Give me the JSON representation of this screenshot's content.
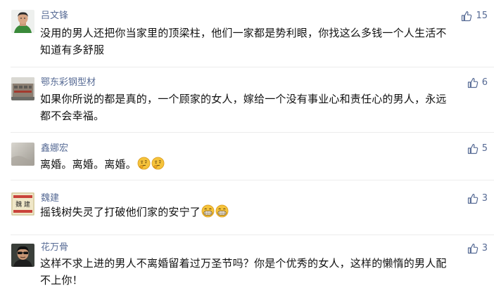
{
  "comments": [
    {
      "user": "吕文锋",
      "likes": "15",
      "text_lines": [
        "没用的男人还把你当家里的顶梁柱，他们一家都是势利眼，你找这么多钱一个人生活不",
        "知道有多舒服"
      ],
      "emoji": []
    },
    {
      "user": "鄂东彩钢型材",
      "likes": "6",
      "text_lines": [
        "如果你所说的都是真的，一个顾家的女人，嫁给一个没有事业心和责任心的男人，永远",
        "都不会幸福。"
      ],
      "emoji": []
    },
    {
      "user": "鑫娜宏",
      "likes": "5",
      "text_lines": [
        "离婚。离婚。离婚。"
      ],
      "emoji": [
        "thinking-emoji",
        "thinking-emoji"
      ]
    },
    {
      "user": "魏建",
      "likes": "3",
      "text_lines": [
        "摇钱树失灵了打破他们家的安宁了"
      ],
      "emoji": [
        "grin-emoji",
        "grin-emoji"
      ]
    },
    {
      "user": "花万骨",
      "likes": "3",
      "text_lines": [
        "这样不求上进的男人不离婚留着过万圣节吗？你是个优秀的女人，这样的懒惰的男人配",
        "不上你！"
      ],
      "emoji": []
    }
  ],
  "avatar_sign_text": "魏 建",
  "colors": {
    "username": "#576b95",
    "text": "#111111",
    "divider": "#ececec",
    "emoji_face": "#f5c33b"
  },
  "icons": {
    "like": "thumbs-up-icon"
  }
}
